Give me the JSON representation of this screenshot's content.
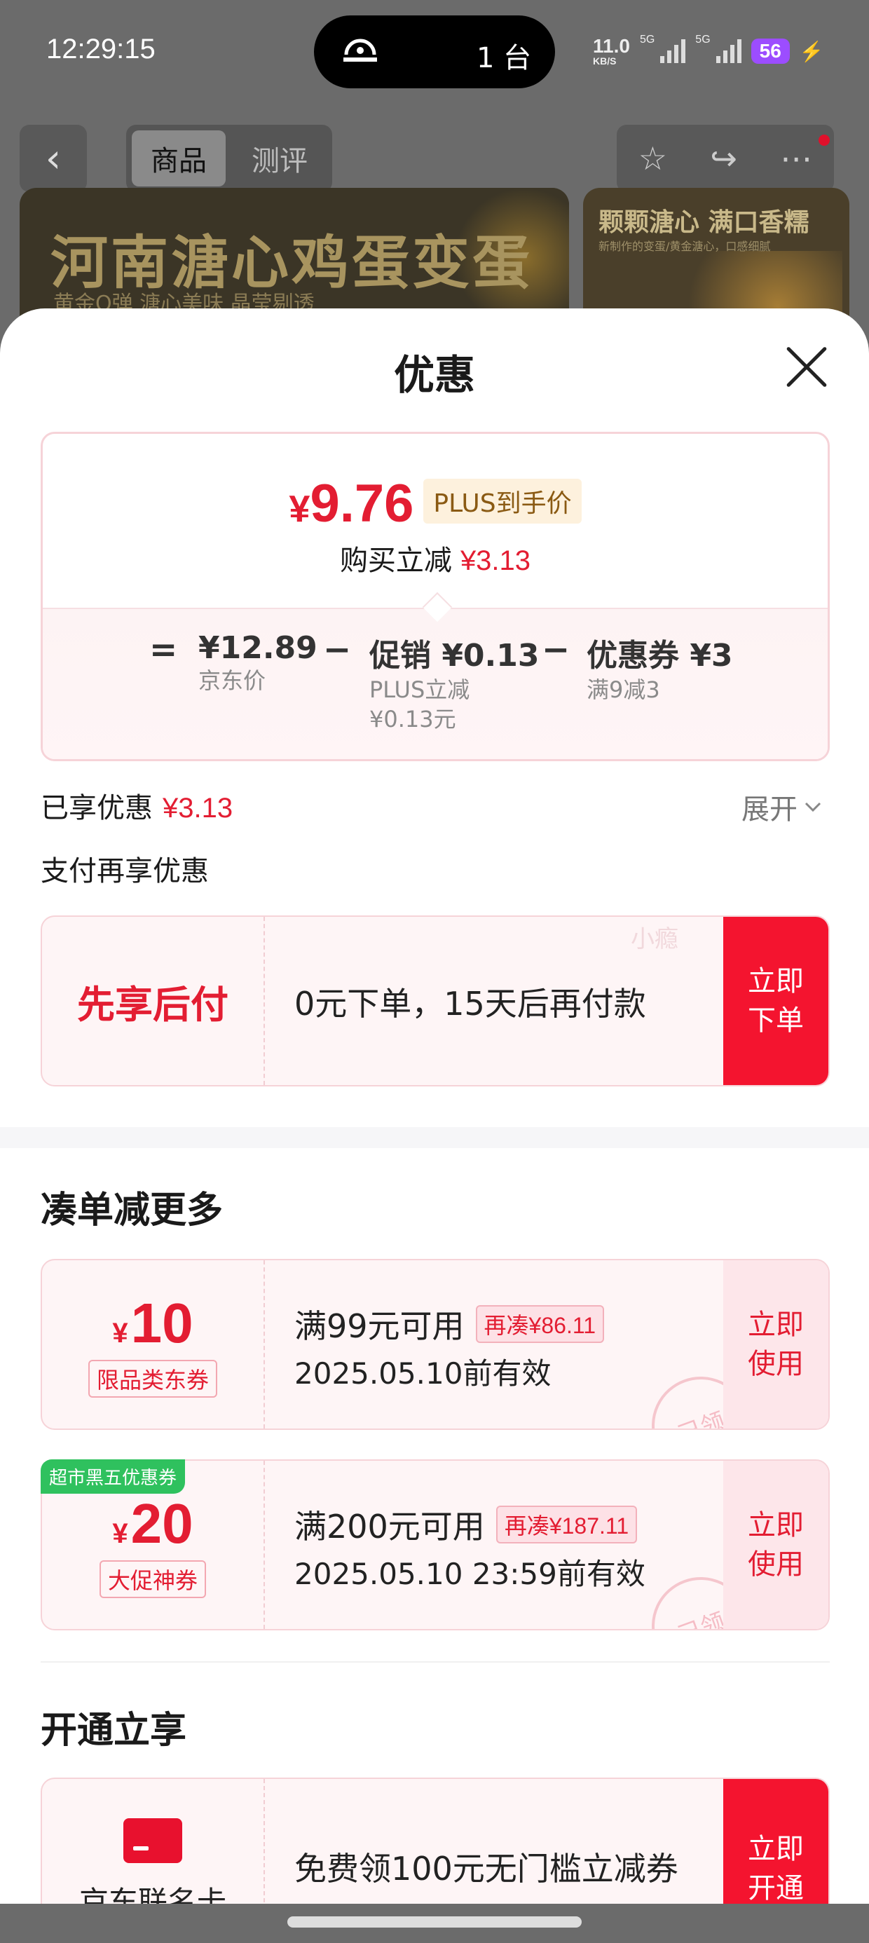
{
  "status_bar": {
    "time": "12:29:15",
    "island_text": "1 台",
    "net_speed": "11.0",
    "net_unit": "KB/S",
    "signal1_label": "5G",
    "signal2_label": "5G",
    "battery": "56"
  },
  "nav": {
    "tabs": [
      {
        "label": "商品",
        "active": true
      },
      {
        "label": "测评",
        "active": false
      }
    ]
  },
  "banner": {
    "title": "河南溏心鸡蛋变蛋",
    "subtitle": "黄金Q弹 溏心美味 晶莹剔透",
    "side_title": "颗颗溏心 满口香糯",
    "side_subtitle": "新制作的变蛋/黄金溏心，口感细腻"
  },
  "sheet": {
    "title": "优惠",
    "price": {
      "currency": "¥",
      "final": "9.76",
      "plus_badge": "PLUS到手价",
      "save_label": "购买立减",
      "save_amount": "¥3.13"
    },
    "formula": {
      "eq": "=",
      "minus": "−",
      "jd_price": "¥12.89",
      "jd_price_label": "京东价",
      "promo": "促销 ¥0.13",
      "promo_sub1": "PLUS立减",
      "promo_sub2": "¥0.13元",
      "coupon": "优惠券 ¥3",
      "coupon_sub": "满9减3"
    },
    "enjoyed_label": "已享优惠",
    "enjoyed_amount": "¥3.13",
    "expand_label": "展开",
    "pay_more_label": "支付再享优惠",
    "bnpl": {
      "title": "先享后付",
      "desc": "0元下单，15天后再付款",
      "watermark": "小瘾",
      "button": "立即下单"
    },
    "more_section_title": "凑单减更多",
    "coupons": [
      {
        "currency": "¥",
        "amount": "10",
        "tag": "限品类东券",
        "condition": "满99元可用",
        "diff": "再凑¥86.11",
        "valid": "2025.05.10前有效",
        "stamp": "已领",
        "button": "立即使用",
        "ribbon": ""
      },
      {
        "currency": "¥",
        "amount": "20",
        "tag": "大促神券",
        "condition": "满200元可用",
        "diff": "再凑¥187.11",
        "valid": "2025.05.10 23:59前有效",
        "stamp": "已领",
        "button": "立即使用",
        "ribbon": "超市黑五优惠券"
      }
    ],
    "open_section_title": "开通立享",
    "open_card": {
      "label": "京东联名卡",
      "desc": "免费领100元无门槛立减券",
      "button": "立即开通"
    }
  },
  "colors": {
    "accent_red": "#e31d32",
    "button_red": "#f4142f",
    "plus_badge_bg": "#fdf1dd",
    "ribbon_green": "#2fc15e"
  }
}
